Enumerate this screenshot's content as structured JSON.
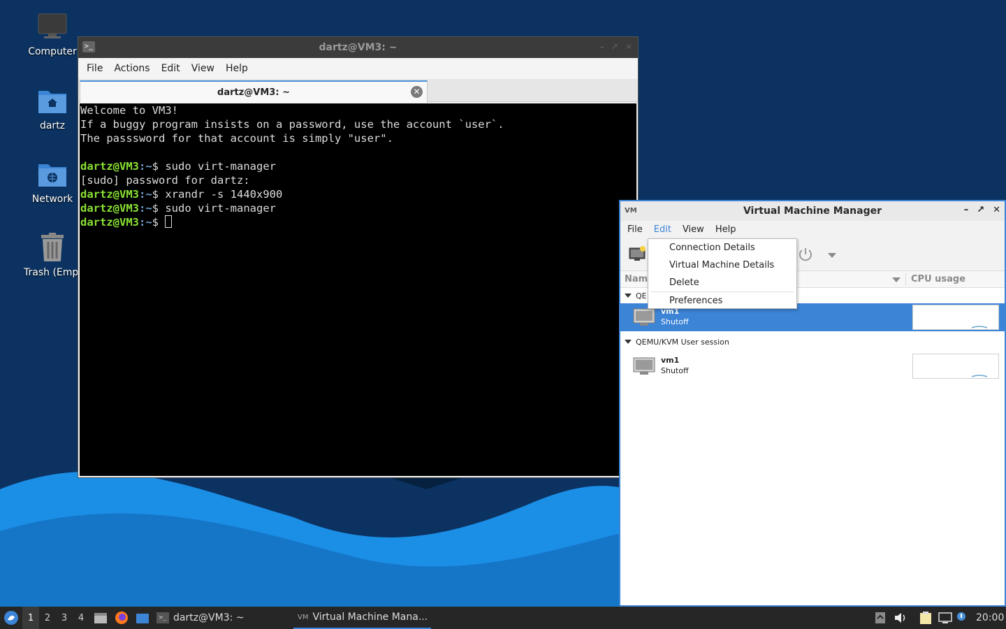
{
  "desktop": {
    "icons": [
      {
        "label": "Computer",
        "icon": "computer-icon"
      },
      {
        "label": "dartz",
        "icon": "home-folder-icon"
      },
      {
        "label": "Network",
        "icon": "network-folder-icon"
      },
      {
        "label": "Trash (Empty)",
        "icon": "trash-icon"
      }
    ]
  },
  "terminal": {
    "title": "dartz@VM3: ~",
    "menu": [
      "File",
      "Actions",
      "Edit",
      "View",
      "Help"
    ],
    "tab_title": "dartz@VM3: ~",
    "prompt_user": "dartz@VM3",
    "prompt_path": ":~",
    "prompt_sym": "$ ",
    "lines": [
      "Welcome to VM3!",
      "If a buggy program insists on a password, use the account `user`.",
      "The passsword for that account is simply \"user\"."
    ],
    "cmd1": "sudo virt-manager",
    "sudo_prompt": "[sudo] password for dartz:",
    "cmd2": "xrandr -s 1440x900",
    "cmd3": "sudo virt-manager"
  },
  "vmm": {
    "title": "Virtual Machine Manager",
    "menu": [
      "File",
      "Edit",
      "View",
      "Help"
    ],
    "col_name": "Nam",
    "col_cpu": "CPU usage",
    "group1": "QE",
    "group2": "QEMU/KVM User session",
    "vm1": {
      "name": "vm1",
      "state": "Shutoff"
    },
    "vm2": {
      "name": "vm1",
      "state": "Shutoff"
    }
  },
  "edit_menu": {
    "items": [
      "Connection Details",
      "Virtual Machine Details",
      "Delete",
      "Preferences"
    ]
  },
  "taskbar": {
    "workspaces": [
      "1",
      "2",
      "3",
      "4"
    ],
    "task1": "dartz@VM3: ~",
    "task2": "Virtual Machine Mana...",
    "clock": "20:00"
  },
  "colors": {
    "accent": "#3c84d6",
    "prompt_green": "#8ae234",
    "prompt_blue": "#729fcf"
  }
}
